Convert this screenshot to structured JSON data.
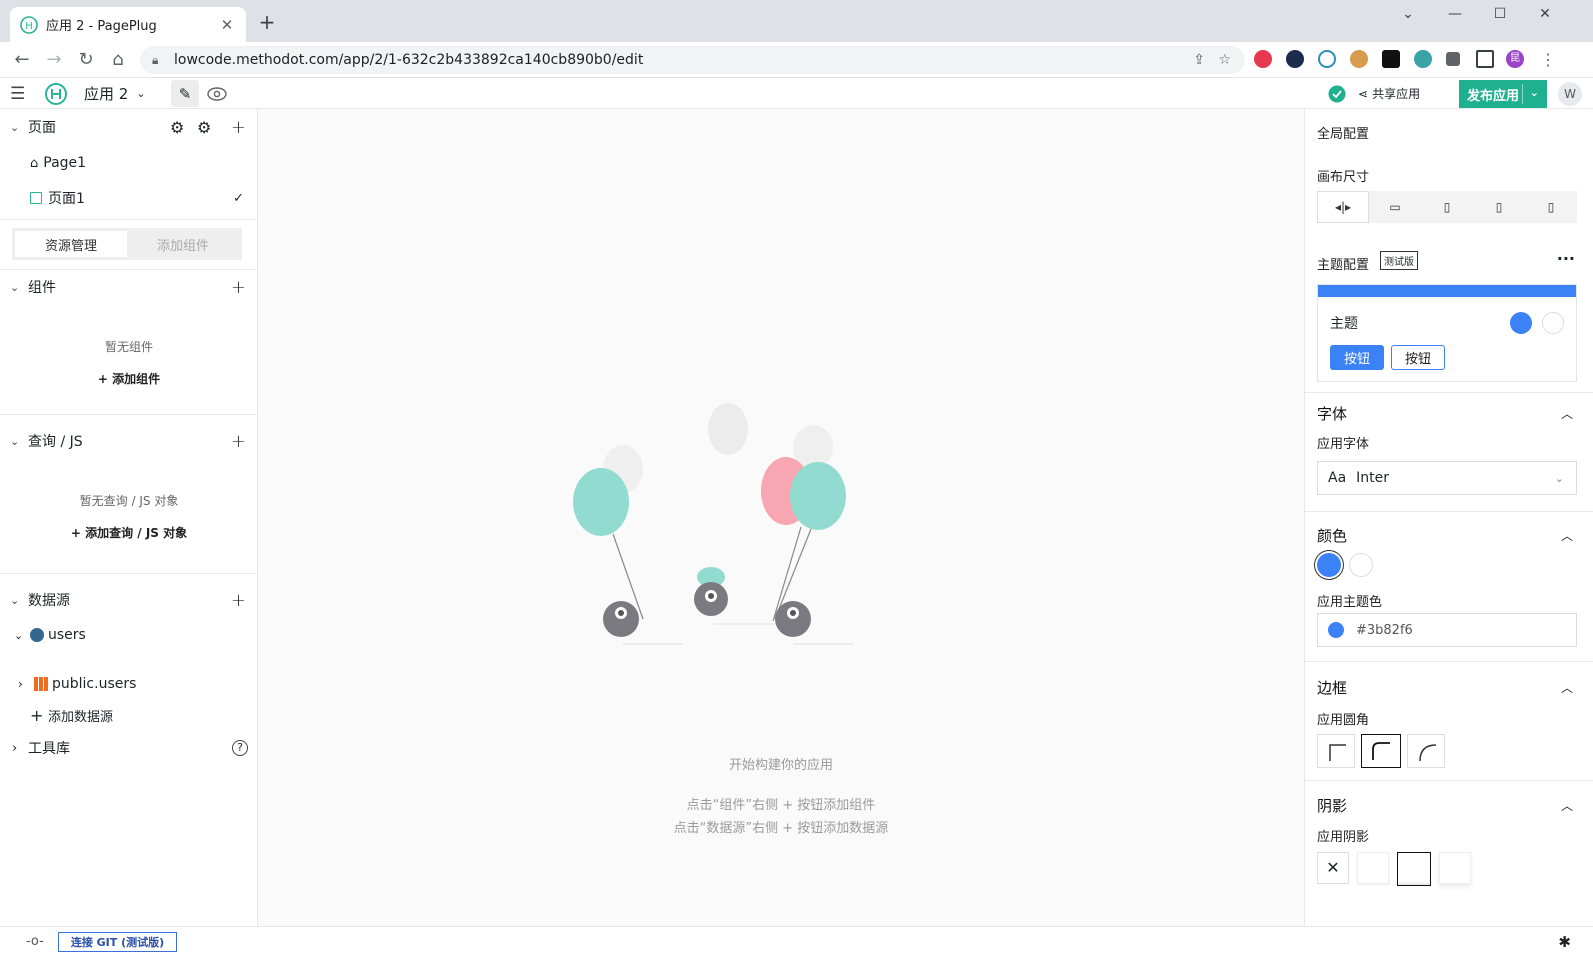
{
  "browser": {
    "tab_title": "应用 2 - PagePlug",
    "url": "lowcode.methodot.com/app/2/1-632c2b433892ca140cb890b0/edit",
    "extensions": [
      "ticktick-icon",
      "check-shield-icon",
      "refresh-r-icon",
      "cookie-icon",
      "sidebar-extension-icon",
      "bird-icon",
      "puzzle-icon",
      "side-panel-icon"
    ],
    "profile_initial": "昆"
  },
  "app_header": {
    "app_name": "应用 2",
    "share_label": "共享应用",
    "publish_label": "发布应用",
    "user_initial": "W"
  },
  "left_panel": {
    "pages_title": "页面",
    "pages": [
      {
        "label": "Page1",
        "icon": "home-icon"
      },
      {
        "label": "页面1",
        "icon": "page-icon",
        "selected": true
      }
    ],
    "tabs": {
      "explorer": "资源管理",
      "widgets": "添加组件"
    },
    "components": {
      "title": "组件",
      "empty": "暂无组件",
      "add": "添加组件"
    },
    "queries": {
      "title": "查询 / JS",
      "empty": "暂无查询 / JS 对象",
      "add": "添加查询 / JS 对象"
    },
    "datasources": {
      "title": "数据源",
      "items": [
        {
          "name": "users",
          "children": [
            "public.users"
          ]
        }
      ],
      "add": "添加数据源"
    },
    "library": {
      "title": "工具库"
    }
  },
  "canvas": {
    "title": "开始构建你的应用",
    "hint1": "点击“组件”右侧 + 按钮添加组件",
    "hint2": "点击“数据源”右侧 + 按钮添加数据源"
  },
  "right_panel": {
    "global_title": "全局配置",
    "canvas_size": "画布尺寸",
    "theme_config": "主题配置",
    "beta": "测试版",
    "theme_card": {
      "name": "主题",
      "btn_primary": "按钮",
      "btn_secondary": "按钮"
    },
    "font_section": "字体",
    "app_font_label": "应用字体",
    "font_prefix": "Aa",
    "font_value": "Inter",
    "color_section": "颜色",
    "app_primary_label": "应用主题色",
    "primary_color": "#3b82f6",
    "border_section": "边框",
    "app_radius_label": "应用圆角",
    "shadow_section": "阴影",
    "app_shadow_label": "应用阴影"
  },
  "footer": {
    "git_label": "连接 GIT (测试版)"
  },
  "colors": {
    "accent": "#1fb090",
    "primary": "#3b82f6"
  }
}
